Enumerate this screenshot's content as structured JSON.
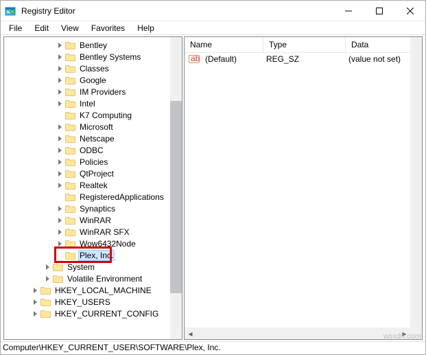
{
  "window": {
    "title": "Registry Editor"
  },
  "menu": {
    "file": "File",
    "edit": "Edit",
    "view": "View",
    "favorites": "Favorites",
    "help": "Help"
  },
  "tree": {
    "items": [
      {
        "indent": 4,
        "expander": true,
        "label": "Bentley"
      },
      {
        "indent": 4,
        "expander": true,
        "label": "Bentley Systems"
      },
      {
        "indent": 4,
        "expander": true,
        "label": "Classes"
      },
      {
        "indent": 4,
        "expander": true,
        "label": "Google"
      },
      {
        "indent": 4,
        "expander": true,
        "label": "IM Providers"
      },
      {
        "indent": 4,
        "expander": true,
        "label": "Intel"
      },
      {
        "indent": 4,
        "expander": false,
        "label": "K7 Computing"
      },
      {
        "indent": 4,
        "expander": true,
        "label": "Microsoft"
      },
      {
        "indent": 4,
        "expander": true,
        "label": "Netscape"
      },
      {
        "indent": 4,
        "expander": true,
        "label": "ODBC"
      },
      {
        "indent": 4,
        "expander": true,
        "label": "Policies"
      },
      {
        "indent": 4,
        "expander": true,
        "label": "QtProject"
      },
      {
        "indent": 4,
        "expander": true,
        "label": "Realtek"
      },
      {
        "indent": 4,
        "expander": false,
        "label": "RegisteredApplications"
      },
      {
        "indent": 4,
        "expander": true,
        "label": "Synaptics"
      },
      {
        "indent": 4,
        "expander": true,
        "label": "WinRAR"
      },
      {
        "indent": 4,
        "expander": true,
        "label": "WinRAR SFX"
      },
      {
        "indent": 4,
        "expander": true,
        "label": "Wow6432Node"
      },
      {
        "indent": 4,
        "expander": false,
        "label": "Plex, Inc.",
        "selected": true,
        "highlight": true
      },
      {
        "indent": 3,
        "expander": true,
        "label": "System"
      },
      {
        "indent": 3,
        "expander": true,
        "label": "Volatile Environment"
      },
      {
        "indent": 2,
        "expander": true,
        "label": "HKEY_LOCAL_MACHINE"
      },
      {
        "indent": 2,
        "expander": true,
        "label": "HKEY_USERS"
      },
      {
        "indent": 2,
        "expander": true,
        "label": "HKEY_CURRENT_CONFIG"
      }
    ]
  },
  "list": {
    "columns": {
      "name": "Name",
      "type": "Type",
      "data": "Data"
    },
    "rows": [
      {
        "name": "(Default)",
        "type": "REG_SZ",
        "data": "(value not set)"
      }
    ]
  },
  "status": {
    "path": "Computer\\HKEY_CURRENT_USER\\SOFTWARE\\Plex, Inc."
  },
  "watermark": "wsxdn.com",
  "colors": {
    "highlight": "#d30000",
    "selection_bg": "#cce8ff",
    "selection_border": "#99d1ff"
  }
}
